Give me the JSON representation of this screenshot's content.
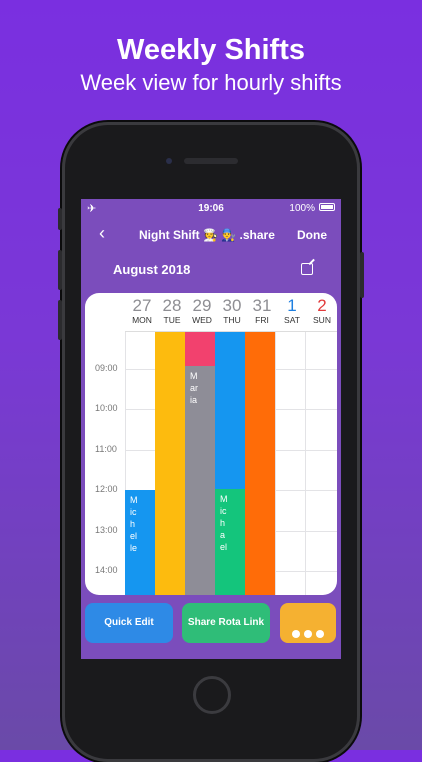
{
  "promo": {
    "title": "Weekly Shifts",
    "subtitle": "Week view for hourly shifts"
  },
  "status": {
    "time": "19:06",
    "battery": "100%",
    "airplane": "✈"
  },
  "nav": {
    "back": "‹",
    "title": "Night Shift 🧑‍🍳 👨‍🔧 .share",
    "done": "Done"
  },
  "calendar": {
    "month": "August 2018",
    "days": [
      {
        "num": "27",
        "wd": "MON",
        "color": "#8e8e93"
      },
      {
        "num": "28",
        "wd": "TUE",
        "color": "#8e8e93"
      },
      {
        "num": "29",
        "wd": "WED",
        "color": "#8e8e93"
      },
      {
        "num": "30",
        "wd": "THU",
        "color": "#8e8e93"
      },
      {
        "num": "31",
        "wd": "FRI",
        "color": "#8e8e93"
      },
      {
        "num": "1",
        "wd": "SAT",
        "color": "#1e7fe0"
      },
      {
        "num": "2",
        "wd": "SUN",
        "color": "#e23b3b"
      }
    ],
    "times": [
      "09:00",
      "10:00",
      "11:00",
      "12:00",
      "13:00",
      "14:00"
    ],
    "shift_names": {
      "michelle": "Michelle",
      "maria": "Maria",
      "michael": "Michael"
    }
  },
  "actions": {
    "quick_edit": "Quick Edit",
    "share": "Share Rota Link"
  },
  "colors": {
    "blue": "#1596f0",
    "yellow": "#fdbb0e",
    "pink": "#f2416e",
    "gray": "#8e8d97",
    "green": "#14c57c",
    "orange": "#ff6c08",
    "purple": "#7b4dbc"
  }
}
